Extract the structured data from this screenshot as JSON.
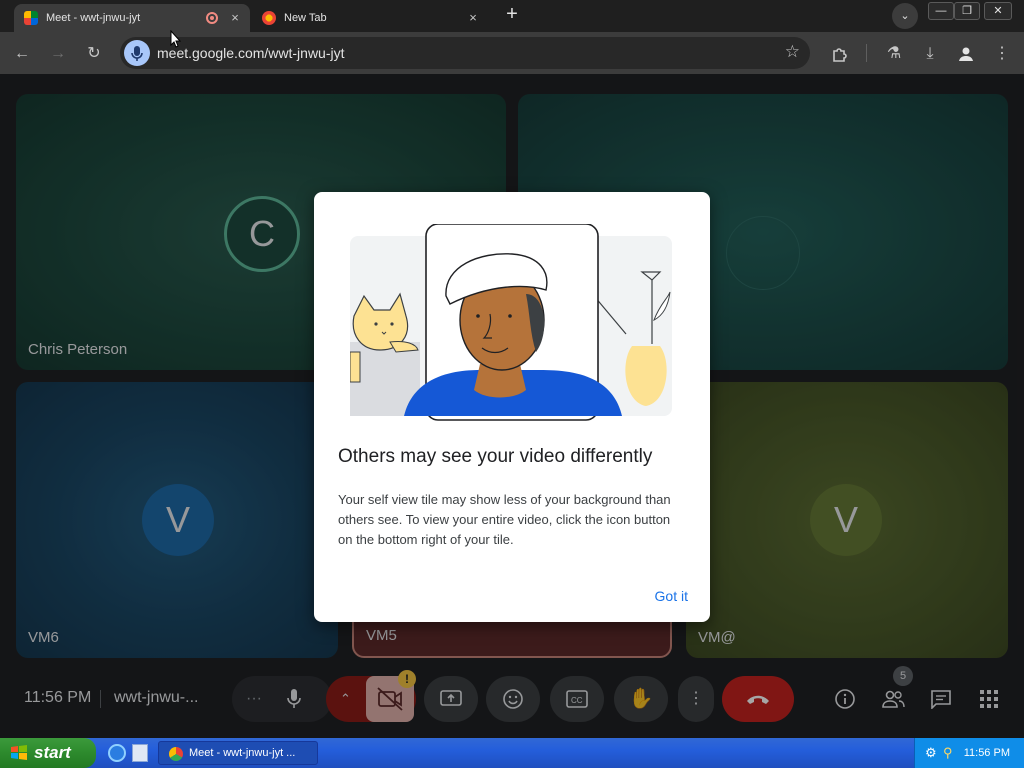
{
  "browser": {
    "tabs": [
      {
        "title": "Meet - wwt-jnwu-jyt"
      },
      {
        "title": "New Tab"
      }
    ],
    "new_tab_label": "+",
    "close_glyph": "×",
    "url": "meet.google.com/wwt-jnwu-jyt",
    "icons": [
      "back-icon",
      "forward-icon",
      "reload-icon",
      "star-icon",
      "extensions-icon",
      "labs-icon",
      "download-icon",
      "profile-icon",
      "menu-icon"
    ]
  },
  "meet": {
    "tiles": [
      {
        "name": "Chris Peterson",
        "initial": "C",
        "color": "#1e4a3f"
      },
      {
        "name": "",
        "initial": "",
        "color": "#1c4c48"
      },
      {
        "name": "VM6",
        "initial": "V",
        "color": "#1a4562"
      },
      {
        "name": "VM5",
        "initial": "",
        "color": "#5c2a2a"
      },
      {
        "name": "VM@",
        "initial": "V",
        "color": "#4b5a2a"
      }
    ],
    "dialog": {
      "title": "Others may see your video differently",
      "body": "Your self view tile may show less of your background than others see. To view your entire video, click the icon button on the bottom right of your tile.",
      "confirm": "Got it"
    },
    "bottom_bar": {
      "time": "11:56 PM",
      "meeting_code": "wwt-jnwu-...",
      "participants_badge": "5",
      "more_label": "···",
      "controls": [
        "mic-icon",
        "camera-options-icon",
        "camera-off-icon",
        "present-icon",
        "emoji-icon",
        "captions-icon",
        "raise-hand-icon",
        "more-options-icon",
        "end-call-icon"
      ],
      "right_controls": [
        "info-icon",
        "people-icon",
        "chat-icon",
        "activities-icon"
      ]
    }
  },
  "taskbar": {
    "start_label": "start",
    "task_title": "Meet - wwt-jnwu-jyt ...",
    "tray_time": "11:56 PM"
  },
  "colors": {
    "accent": "#1a73e8",
    "end_call": "#c5221f",
    "camera_off": "#8c1d18"
  }
}
